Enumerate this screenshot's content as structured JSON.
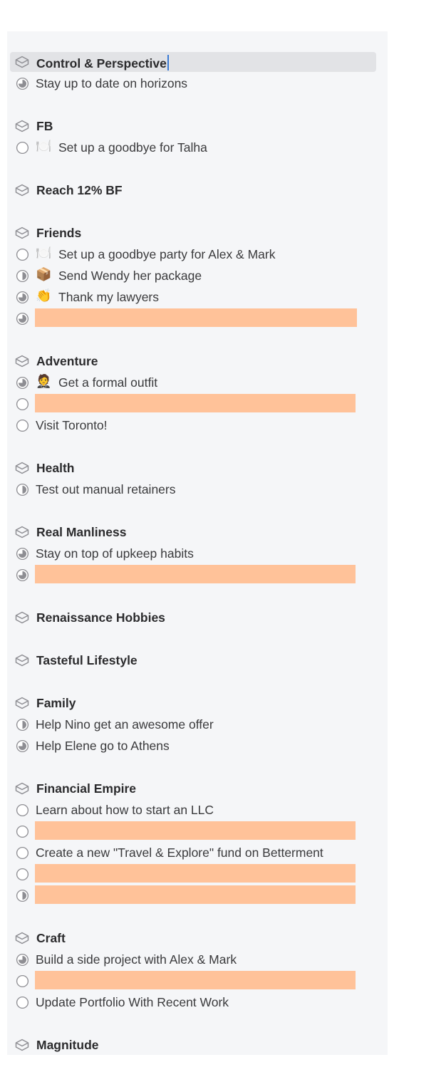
{
  "colors": {
    "redaction": "#ffc299",
    "selection": "#e2e3e6",
    "caret": "#3a7bd5",
    "icon_stroke": "#8e8e93"
  },
  "rows": [
    {
      "type": "project",
      "title": "Control & Perspective",
      "selected": true,
      "caret": true
    },
    {
      "type": "action",
      "status": "three-quarter",
      "text": "Stay up to date on horizons"
    },
    {
      "type": "gap"
    },
    {
      "type": "project",
      "title": "FB"
    },
    {
      "type": "action",
      "status": "empty",
      "emoji": "🍽️",
      "text": "Set up a goodbye for Talha"
    },
    {
      "type": "gap"
    },
    {
      "type": "project",
      "title": "Reach 12% BF"
    },
    {
      "type": "gap"
    },
    {
      "type": "project",
      "title": "Friends"
    },
    {
      "type": "action",
      "status": "empty",
      "emoji": "🍽️",
      "text": "Set up a goodbye party for Alex & Mark"
    },
    {
      "type": "action",
      "status": "half",
      "emoji": "📦",
      "text": "Send Wendy her package"
    },
    {
      "type": "action",
      "status": "three-quarter",
      "emoji": "👏",
      "text": "Thank my lawyers"
    },
    {
      "type": "action",
      "status": "three-quarter",
      "redacted": true
    },
    {
      "type": "gap"
    },
    {
      "type": "project",
      "title": "Adventure"
    },
    {
      "type": "action",
      "status": "three-quarter",
      "emoji": "🤵",
      "text": "Get a formal outfit"
    },
    {
      "type": "action",
      "status": "empty",
      "redacted": true
    },
    {
      "type": "action",
      "status": "empty",
      "text": "Visit Toronto!"
    },
    {
      "type": "gap"
    },
    {
      "type": "project",
      "title": "Health"
    },
    {
      "type": "action",
      "status": "half",
      "text": "Test out manual retainers"
    },
    {
      "type": "gap"
    },
    {
      "type": "project",
      "title": "Real Manliness"
    },
    {
      "type": "action",
      "status": "three-quarter",
      "text": "Stay on top of upkeep habits"
    },
    {
      "type": "action",
      "status": "three-quarter",
      "redacted": true
    },
    {
      "type": "gap"
    },
    {
      "type": "project",
      "title": "Renaissance Hobbies"
    },
    {
      "type": "gap"
    },
    {
      "type": "project",
      "title": "Tasteful Lifestyle"
    },
    {
      "type": "gap"
    },
    {
      "type": "project",
      "title": "Family"
    },
    {
      "type": "action",
      "status": "half",
      "text": "Help Nino get an awesome offer"
    },
    {
      "type": "action",
      "status": "three-quarter",
      "text": "Help Elene go to Athens"
    },
    {
      "type": "gap"
    },
    {
      "type": "project",
      "title": "Financial Empire"
    },
    {
      "type": "action",
      "status": "empty",
      "text": "Learn about how to start an LLC"
    },
    {
      "type": "action",
      "status": "empty",
      "redacted": true
    },
    {
      "type": "action",
      "status": "empty",
      "text": "Create a new \"Travel & Explore\" fund on Betterment"
    },
    {
      "type": "action",
      "status": "empty",
      "redacted": true
    },
    {
      "type": "action",
      "status": "half",
      "redacted": true
    },
    {
      "type": "gap"
    },
    {
      "type": "project",
      "title": "Craft"
    },
    {
      "type": "action",
      "status": "three-quarter",
      "text": "Build a side project with Alex & Mark"
    },
    {
      "type": "action",
      "status": "empty",
      "redacted": true
    },
    {
      "type": "action",
      "status": "empty",
      "text": "Update Portfolio With Recent Work"
    },
    {
      "type": "gap"
    },
    {
      "type": "project",
      "title": "Magnitude"
    }
  ]
}
